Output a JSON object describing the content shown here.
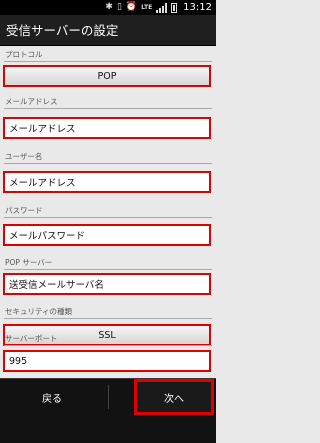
{
  "status_bar": {
    "time": "13:12",
    "network": "LTE",
    "icons": [
      "bluetooth-icon",
      "vibrate-icon",
      "alarm-icon",
      "lte-icon",
      "signal-icon",
      "battery-icon"
    ]
  },
  "header": {
    "title": "受信サーバーの設定"
  },
  "fields": [
    {
      "label": "プロトコル",
      "value": "POP",
      "kind": "button"
    },
    {
      "label": "メールアドレス",
      "value": "メールアドレス",
      "kind": "input"
    },
    {
      "label": "ユーザー名",
      "value": "メールアドレス",
      "kind": "input"
    },
    {
      "label": "パスワード",
      "value": "メールパスワード",
      "kind": "input"
    },
    {
      "label": "POP サーバー",
      "value": "送受信メールサーバ名",
      "kind": "input"
    },
    {
      "label": "セキュリティの種類",
      "value": "SSL",
      "kind": "button"
    },
    {
      "label": "サーバーポート",
      "value": "995",
      "kind": "input"
    }
  ],
  "footer": {
    "back_label": "戻る",
    "next_label": "次へ"
  },
  "colors": {
    "highlight": "#e00000",
    "title_bg": "#1f1f1f",
    "background": "#e9e9e9"
  }
}
